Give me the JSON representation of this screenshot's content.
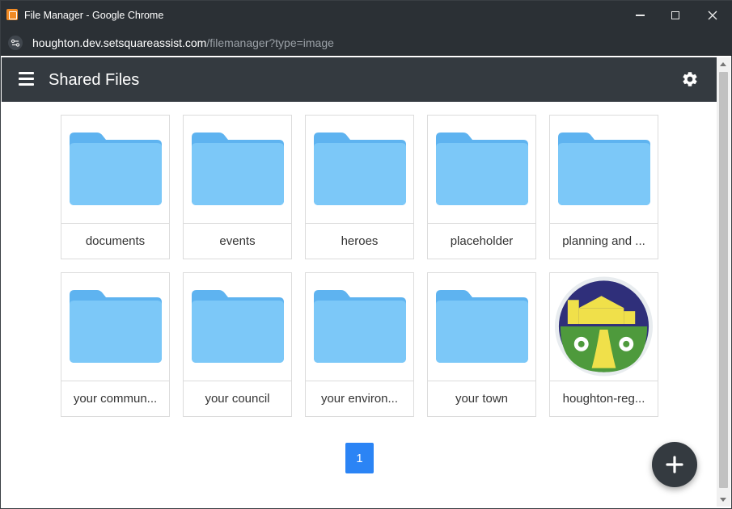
{
  "window": {
    "title": "File Manager - Google Chrome",
    "url_host": "houghton.dev.setsquareassist.com",
    "url_path": "/filemanager?type=image"
  },
  "appbar": {
    "title": "Shared Files"
  },
  "tiles": [
    {
      "label": "documents",
      "kind": "folder"
    },
    {
      "label": "events",
      "kind": "folder"
    },
    {
      "label": "heroes",
      "kind": "folder"
    },
    {
      "label": "placeholder",
      "kind": "folder"
    },
    {
      "label": "planning and ...",
      "kind": "folder"
    },
    {
      "label": "your commun...",
      "kind": "folder"
    },
    {
      "label": "your council",
      "kind": "folder"
    },
    {
      "label": "your environ...",
      "kind": "folder"
    },
    {
      "label": "your town",
      "kind": "folder"
    },
    {
      "label": "houghton-reg...",
      "kind": "image"
    }
  ],
  "pagination": {
    "current": "1"
  },
  "colors": {
    "accent": "#2b84f5",
    "appbar": "#343a40",
    "folder": "#7cc8f8"
  }
}
